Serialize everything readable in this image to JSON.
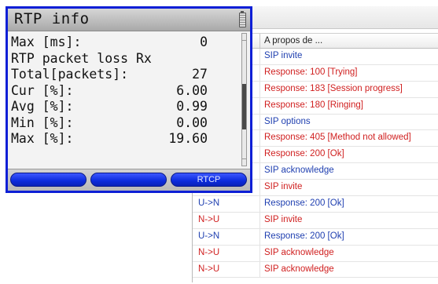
{
  "rtp_window": {
    "title": "RTP info",
    "lines": [
      {
        "label": "Max [ms]:",
        "value": "0"
      },
      {
        "label": "RTP packet loss Rx",
        "value": ""
      },
      {
        "label": "Total[packets]:",
        "value": "27"
      },
      {
        "label": "Cur [%]:",
        "value": "6.00"
      },
      {
        "label": "Avg [%]:",
        "value": "0.99"
      },
      {
        "label": "Min [%]:",
        "value": "0.00"
      },
      {
        "label": "Max [%]:",
        "value": "19.60"
      }
    ],
    "softkeys": [
      "",
      "",
      "RTCP"
    ],
    "accent_color": "#0d1fd6"
  },
  "trace_table": {
    "header": {
      "direction": "",
      "about": "A propos de ..."
    },
    "rows": [
      {
        "direction": "",
        "about": "SIP invite",
        "color": "blue"
      },
      {
        "direction": "",
        "about": "Response: 100 [Trying]",
        "color": "red"
      },
      {
        "direction": "",
        "about": "Response: 183 [Session progress]",
        "color": "red"
      },
      {
        "direction": "",
        "about": "Response: 180 [Ringing]",
        "color": "red"
      },
      {
        "direction": "",
        "about": "SIP options",
        "color": "blue"
      },
      {
        "direction": "",
        "about": "Response: 405 [Method not allowed]",
        "color": "red"
      },
      {
        "direction": "",
        "about": "Response: 200 [Ok]",
        "color": "red"
      },
      {
        "direction": "",
        "about": "SIP acknowledge",
        "color": "blue"
      },
      {
        "direction": "",
        "about": "SIP invite",
        "color": "red"
      },
      {
        "direction": "U->N",
        "about": "Response: 200 [Ok]",
        "color": "blue"
      },
      {
        "direction": "N->U",
        "about": "SIP invite",
        "color": "red"
      },
      {
        "direction": "U->N",
        "about": "Response: 200 [Ok]",
        "color": "blue"
      },
      {
        "direction": "N->U",
        "about": "SIP acknowledge",
        "color": "red"
      },
      {
        "direction": "N->U",
        "about": "SIP acknowledge",
        "color": "red"
      }
    ],
    "colors": {
      "blue": "#1f3fb0",
      "red": "#d01f1f"
    }
  }
}
